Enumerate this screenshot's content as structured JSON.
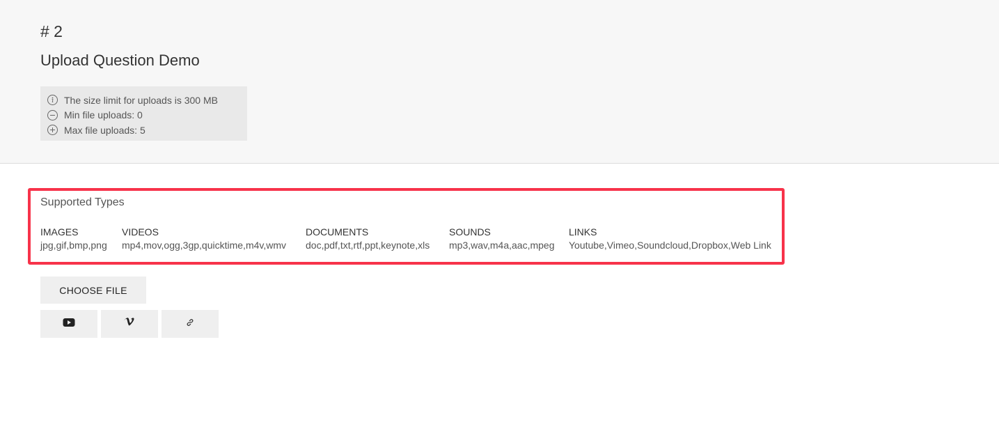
{
  "question": {
    "number": "# 2",
    "title": "Upload Question Demo"
  },
  "info": {
    "size_limit": "The size limit for uploads is 300 MB",
    "min_uploads": "Min file uploads: 0",
    "max_uploads": "Max file uploads: 5",
    "icons": [
      "info-icon",
      "minus-circle-icon",
      "plus-circle-icon"
    ]
  },
  "supported": {
    "title": "Supported Types",
    "types": [
      {
        "label": "IMAGES",
        "values": "jpg,gif,bmp,png"
      },
      {
        "label": "VIDEOS",
        "values": "mp4,mov,ogg,3gp,quicktime,m4v,wmv"
      },
      {
        "label": "DOCUMENTS",
        "values": "doc,pdf,txt,rtf,ppt,keynote,xls"
      },
      {
        "label": "SOUNDS",
        "values": "mp3,wav,m4a,aac,mpeg"
      },
      {
        "label": "LINKS",
        "values": "Youtube,Vimeo,Soundcloud,Dropbox,Web Link"
      }
    ],
    "highlight_color": "#f7334a"
  },
  "actions": {
    "choose_file": "CHOOSE FILE",
    "link_buttons": [
      "youtube-icon",
      "vimeo-icon",
      "link-icon"
    ]
  }
}
